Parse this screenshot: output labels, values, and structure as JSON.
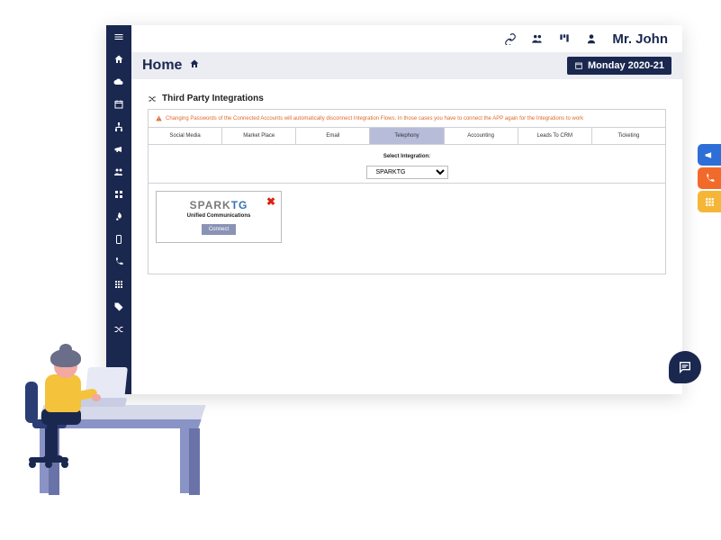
{
  "header": {
    "user_name": "Mr. John"
  },
  "pagebar": {
    "title": "Home",
    "date_label": "Monday 2020-21"
  },
  "panel": {
    "title": "Third Party Integrations",
    "warning": "Changing Passwords of the Connected Accounts will automatically disconnect Integration Flows. In those cases you have to connect the APP again for the Integrations to work",
    "tabs": [
      "Social Media",
      "Market Place",
      "Email",
      "Telephony",
      "Accounting",
      "Leads To CRM",
      "Ticketing"
    ],
    "active_tab_index": 3,
    "select_label": "Select Integration:",
    "select_value": "SPARKTG",
    "card": {
      "brand_gray": "SPARK",
      "brand_blue": "TG",
      "subtitle": "Unified Communications",
      "button": "Connect"
    }
  }
}
